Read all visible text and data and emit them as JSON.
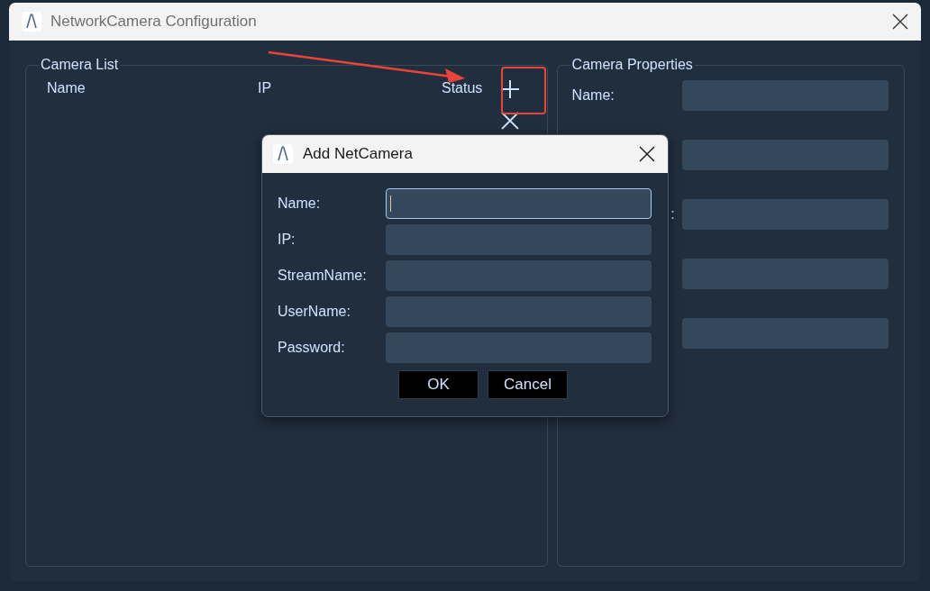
{
  "window": {
    "title": "NetworkCamera Configuration"
  },
  "camera_list": {
    "title": "Camera List",
    "columns": [
      "Name",
      "IP",
      "Status"
    ]
  },
  "camera_properties": {
    "title": "Camera Properties",
    "fields": [
      {
        "kind": "text",
        "label": "Name:"
      },
      {
        "kind": "text"
      },
      {
        "kind": "text",
        "label": ":"
      },
      {
        "kind": "text"
      },
      {
        "kind": "text"
      }
    ]
  },
  "dialog": {
    "title": "Add NetCamera",
    "fields": [
      {
        "label": "Name:",
        "focused": true
      },
      {
        "label": "IP:",
        "focused": false
      },
      {
        "label": "StreamName:",
        "focused": false
      },
      {
        "label": "UserName:",
        "focused": false
      },
      {
        "label": "Password:",
        "focused": false
      }
    ],
    "buttons": [
      "OK",
      "Cancel"
    ]
  }
}
